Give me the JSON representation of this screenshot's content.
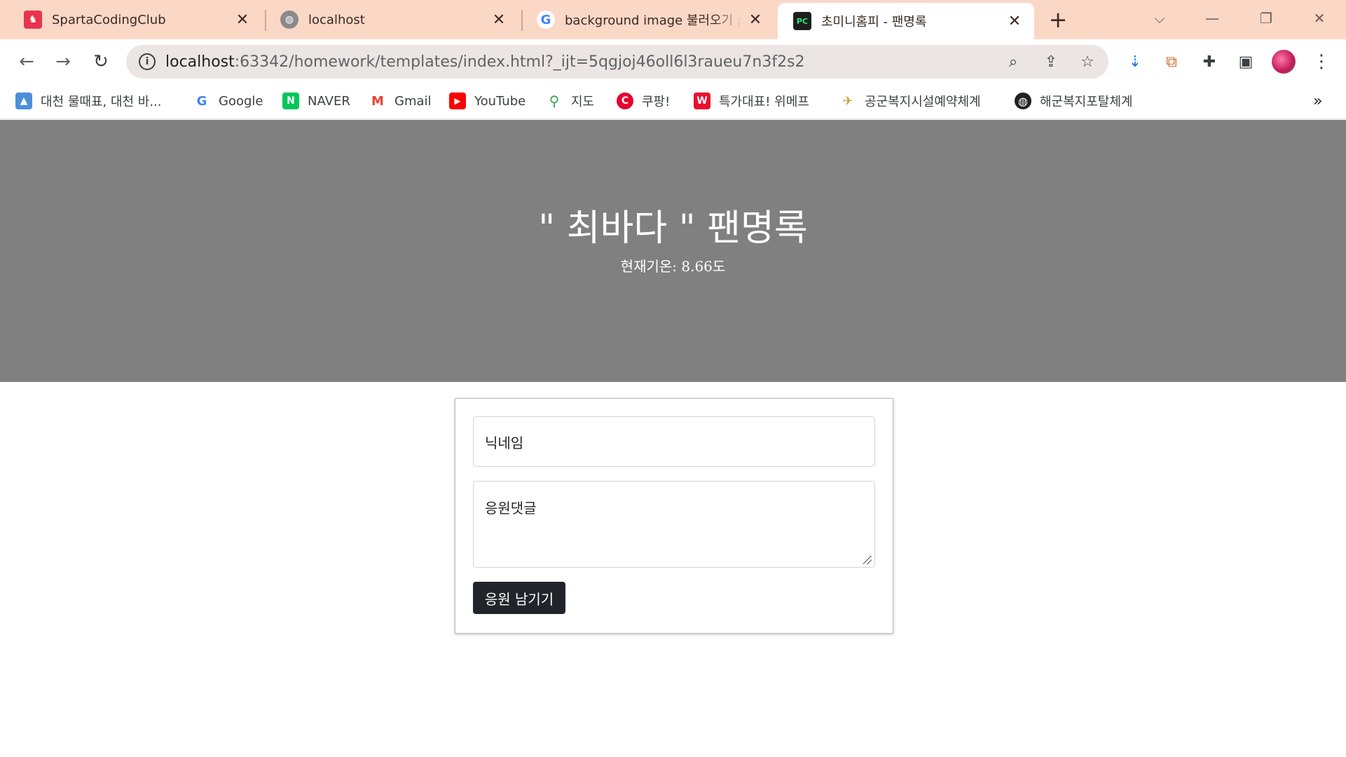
{
  "browser": {
    "tabs": [
      {
        "title": "SpartaCodingClub",
        "active": false
      },
      {
        "title": "localhost",
        "active": false
      },
      {
        "title": "background image 불러오기 python",
        "active": false
      },
      {
        "title": "초미니홈피 - 팬명록",
        "active": true
      }
    ],
    "url_host": "localhost",
    "url_rest": ":63342/homework/templates/index.html?_ijt=5qgjoj46oll6l3raueu7n3f2s2",
    "bookmarks": [
      {
        "label": "대천 물때표, 대천 바...",
        "icon": "image-icon"
      },
      {
        "label": "Google",
        "icon": "google-icon"
      },
      {
        "label": "NAVER",
        "icon": "naver-icon"
      },
      {
        "label": "Gmail",
        "icon": "gmail-icon"
      },
      {
        "label": "YouTube",
        "icon": "youtube-icon"
      },
      {
        "label": "지도",
        "icon": "maps-icon"
      },
      {
        "label": "쿠팡!",
        "icon": "coupang-icon"
      },
      {
        "label": "특가대표! 위메프",
        "icon": "wemakeprice-icon"
      },
      {
        "label": "공군복지시설예약체계",
        "icon": "airforce-icon"
      },
      {
        "label": "해군복지포탈체계",
        "icon": "globe-icon"
      }
    ],
    "bookmarks_overflow": "»"
  },
  "page": {
    "title": "\" 최바다 \" 팬명록",
    "temperature": "현재기온: 8.66도",
    "form": {
      "nickname_placeholder": "닉네임",
      "comment_placeholder": "응원댓글",
      "submit_label": "응원 남기기"
    }
  },
  "colors": {
    "tabstrip": "#fbd7c6",
    "hero_bg": "#808080",
    "button_bg": "#212529"
  }
}
